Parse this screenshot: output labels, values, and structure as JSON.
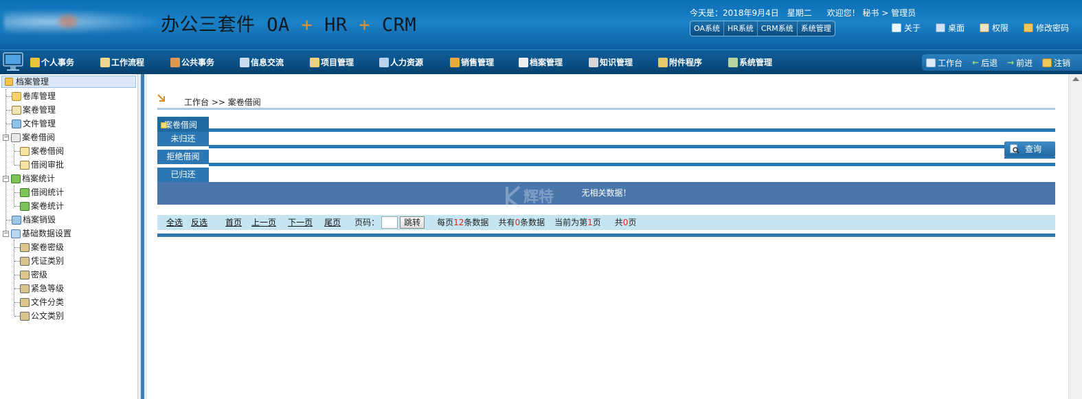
{
  "header": {
    "app_title_main": "办公三套件 OA",
    "app_title_plus": "+",
    "app_title_hr": "HR",
    "app_title_crm": "CRM",
    "date": "今天是：2018年9月4日　星期二",
    "welcome": "欢迎您！ 秘书 > 管理员",
    "sys_tabs": [
      "OA系统",
      "HR系统",
      "CRM系统",
      "系统管理"
    ],
    "links": [
      "关于",
      "桌面",
      "权限",
      "修改密码"
    ]
  },
  "nav": {
    "items": [
      "个人事务",
      "工作流程",
      "公共事务",
      "信息交流",
      "项目管理",
      "人力资源",
      "销售管理",
      "档案管理",
      "知识管理",
      "附件程序",
      "系统管理"
    ],
    "tools": [
      "工作台",
      "后退",
      "前进",
      "注销"
    ]
  },
  "sidebar": {
    "root": "档案管理",
    "items": [
      "卷库管理",
      "案卷管理",
      "文件管理",
      "案卷借阅",
      "案卷借阅",
      "借阅审批",
      "档案统计",
      "借阅统计",
      "案卷统计",
      "档案销毁",
      "基础数据设置",
      "案卷密级",
      "凭证类别",
      "密级",
      "紧急等级",
      "文件分类",
      "公文类别"
    ]
  },
  "main": {
    "breadcrumb": "工作台 >> 案卷借阅",
    "tabs": [
      "案卷借阅",
      "未归还",
      "拒绝借阅",
      "已归还"
    ],
    "query_label": "查询",
    "no_data": "无相关数据！",
    "watermark": "辉特"
  },
  "pager": {
    "select_all": "全选",
    "invert": "反选",
    "first": "首页",
    "prev": "上一页",
    "next": "下一页",
    "last": "尾页",
    "page_label": "页码：",
    "jump": "跳转",
    "per_page_prefix": "每页",
    "per_page_value": "12",
    "per_page_suffix": "条数据",
    "total_prefix": "共有",
    "total_value": "0",
    "total_suffix": "条数据",
    "current_prefix": "当前为第",
    "current_value": "1",
    "current_suffix": "页",
    "pages_prefix": "共",
    "pages_value": "0",
    "pages_suffix": "页"
  }
}
